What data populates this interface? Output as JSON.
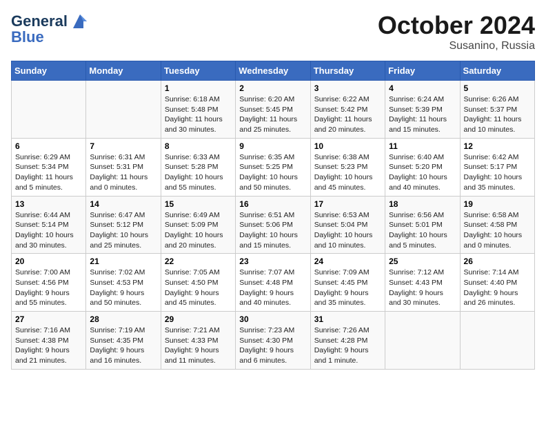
{
  "header": {
    "logo_line1": "General",
    "logo_line2": "Blue",
    "month": "October 2024",
    "location": "Susanino, Russia"
  },
  "weekdays": [
    "Sunday",
    "Monday",
    "Tuesday",
    "Wednesday",
    "Thursday",
    "Friday",
    "Saturday"
  ],
  "weeks": [
    [
      {
        "day": "",
        "info": ""
      },
      {
        "day": "",
        "info": ""
      },
      {
        "day": "1",
        "info": "Sunrise: 6:18 AM\nSunset: 5:48 PM\nDaylight: 11 hours and 30 minutes."
      },
      {
        "day": "2",
        "info": "Sunrise: 6:20 AM\nSunset: 5:45 PM\nDaylight: 11 hours and 25 minutes."
      },
      {
        "day": "3",
        "info": "Sunrise: 6:22 AM\nSunset: 5:42 PM\nDaylight: 11 hours and 20 minutes."
      },
      {
        "day": "4",
        "info": "Sunrise: 6:24 AM\nSunset: 5:39 PM\nDaylight: 11 hours and 15 minutes."
      },
      {
        "day": "5",
        "info": "Sunrise: 6:26 AM\nSunset: 5:37 PM\nDaylight: 11 hours and 10 minutes."
      }
    ],
    [
      {
        "day": "6",
        "info": "Sunrise: 6:29 AM\nSunset: 5:34 PM\nDaylight: 11 hours and 5 minutes."
      },
      {
        "day": "7",
        "info": "Sunrise: 6:31 AM\nSunset: 5:31 PM\nDaylight: 11 hours and 0 minutes."
      },
      {
        "day": "8",
        "info": "Sunrise: 6:33 AM\nSunset: 5:28 PM\nDaylight: 10 hours and 55 minutes."
      },
      {
        "day": "9",
        "info": "Sunrise: 6:35 AM\nSunset: 5:25 PM\nDaylight: 10 hours and 50 minutes."
      },
      {
        "day": "10",
        "info": "Sunrise: 6:38 AM\nSunset: 5:23 PM\nDaylight: 10 hours and 45 minutes."
      },
      {
        "day": "11",
        "info": "Sunrise: 6:40 AM\nSunset: 5:20 PM\nDaylight: 10 hours and 40 minutes."
      },
      {
        "day": "12",
        "info": "Sunrise: 6:42 AM\nSunset: 5:17 PM\nDaylight: 10 hours and 35 minutes."
      }
    ],
    [
      {
        "day": "13",
        "info": "Sunrise: 6:44 AM\nSunset: 5:14 PM\nDaylight: 10 hours and 30 minutes."
      },
      {
        "day": "14",
        "info": "Sunrise: 6:47 AM\nSunset: 5:12 PM\nDaylight: 10 hours and 25 minutes."
      },
      {
        "day": "15",
        "info": "Sunrise: 6:49 AM\nSunset: 5:09 PM\nDaylight: 10 hours and 20 minutes."
      },
      {
        "day": "16",
        "info": "Sunrise: 6:51 AM\nSunset: 5:06 PM\nDaylight: 10 hours and 15 minutes."
      },
      {
        "day": "17",
        "info": "Sunrise: 6:53 AM\nSunset: 5:04 PM\nDaylight: 10 hours and 10 minutes."
      },
      {
        "day": "18",
        "info": "Sunrise: 6:56 AM\nSunset: 5:01 PM\nDaylight: 10 hours and 5 minutes."
      },
      {
        "day": "19",
        "info": "Sunrise: 6:58 AM\nSunset: 4:58 PM\nDaylight: 10 hours and 0 minutes."
      }
    ],
    [
      {
        "day": "20",
        "info": "Sunrise: 7:00 AM\nSunset: 4:56 PM\nDaylight: 9 hours and 55 minutes."
      },
      {
        "day": "21",
        "info": "Sunrise: 7:02 AM\nSunset: 4:53 PM\nDaylight: 9 hours and 50 minutes."
      },
      {
        "day": "22",
        "info": "Sunrise: 7:05 AM\nSunset: 4:50 PM\nDaylight: 9 hours and 45 minutes."
      },
      {
        "day": "23",
        "info": "Sunrise: 7:07 AM\nSunset: 4:48 PM\nDaylight: 9 hours and 40 minutes."
      },
      {
        "day": "24",
        "info": "Sunrise: 7:09 AM\nSunset: 4:45 PM\nDaylight: 9 hours and 35 minutes."
      },
      {
        "day": "25",
        "info": "Sunrise: 7:12 AM\nSunset: 4:43 PM\nDaylight: 9 hours and 30 minutes."
      },
      {
        "day": "26",
        "info": "Sunrise: 7:14 AM\nSunset: 4:40 PM\nDaylight: 9 hours and 26 minutes."
      }
    ],
    [
      {
        "day": "27",
        "info": "Sunrise: 7:16 AM\nSunset: 4:38 PM\nDaylight: 9 hours and 21 minutes."
      },
      {
        "day": "28",
        "info": "Sunrise: 7:19 AM\nSunset: 4:35 PM\nDaylight: 9 hours and 16 minutes."
      },
      {
        "day": "29",
        "info": "Sunrise: 7:21 AM\nSunset: 4:33 PM\nDaylight: 9 hours and 11 minutes."
      },
      {
        "day": "30",
        "info": "Sunrise: 7:23 AM\nSunset: 4:30 PM\nDaylight: 9 hours and 6 minutes."
      },
      {
        "day": "31",
        "info": "Sunrise: 7:26 AM\nSunset: 4:28 PM\nDaylight: 9 hours and 1 minute."
      },
      {
        "day": "",
        "info": ""
      },
      {
        "day": "",
        "info": ""
      }
    ]
  ]
}
